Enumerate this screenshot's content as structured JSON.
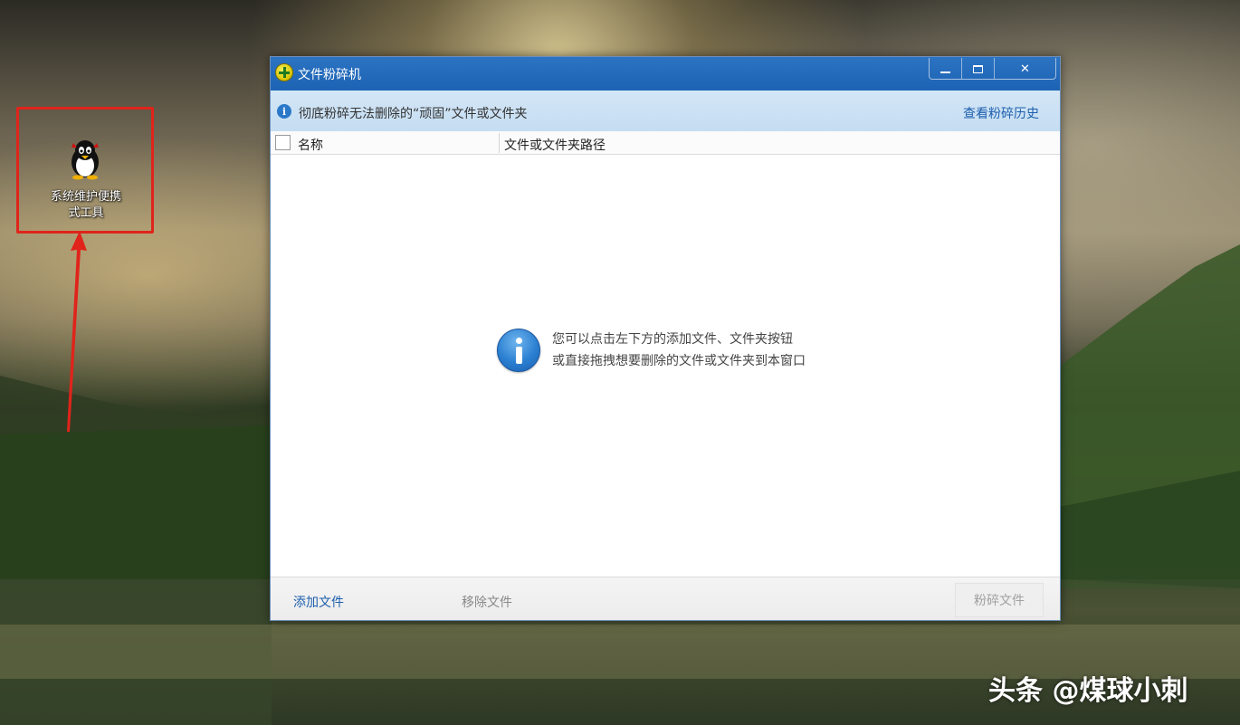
{
  "desktop": {
    "icon_label_line1": "系统维护便携",
    "icon_label_line2": "式工具",
    "icon": "penguin-icon"
  },
  "window": {
    "title": "文件粉碎机",
    "app_icon": "shredder-app-icon",
    "controls": {
      "minimize_icon": "minimize-icon",
      "maximize_icon": "maximize-icon",
      "close_label": "✕"
    }
  },
  "infobar": {
    "text": "彻底粉碎无法删除的“顽固”文件或文件夹",
    "history_link": "查看粉碎历史",
    "info_icon_glyph": "i"
  },
  "table": {
    "columns": [
      "名称",
      "文件或文件夹路径"
    ]
  },
  "hint": {
    "line1": "您可以点击左下方的添加文件、文件夹按钮",
    "line2": "或直接拖拽想要删除的文件或文件夹到本窗口"
  },
  "footer": {
    "add_file": "添加文件",
    "remove_file": "移除文件",
    "shred_file": "粉碎文件"
  },
  "watermark": "头条 @煤球小刺",
  "colors": {
    "titlebar": "#1d63b4",
    "highlight_frame": "#e0241b",
    "link": "#1d5fae"
  }
}
